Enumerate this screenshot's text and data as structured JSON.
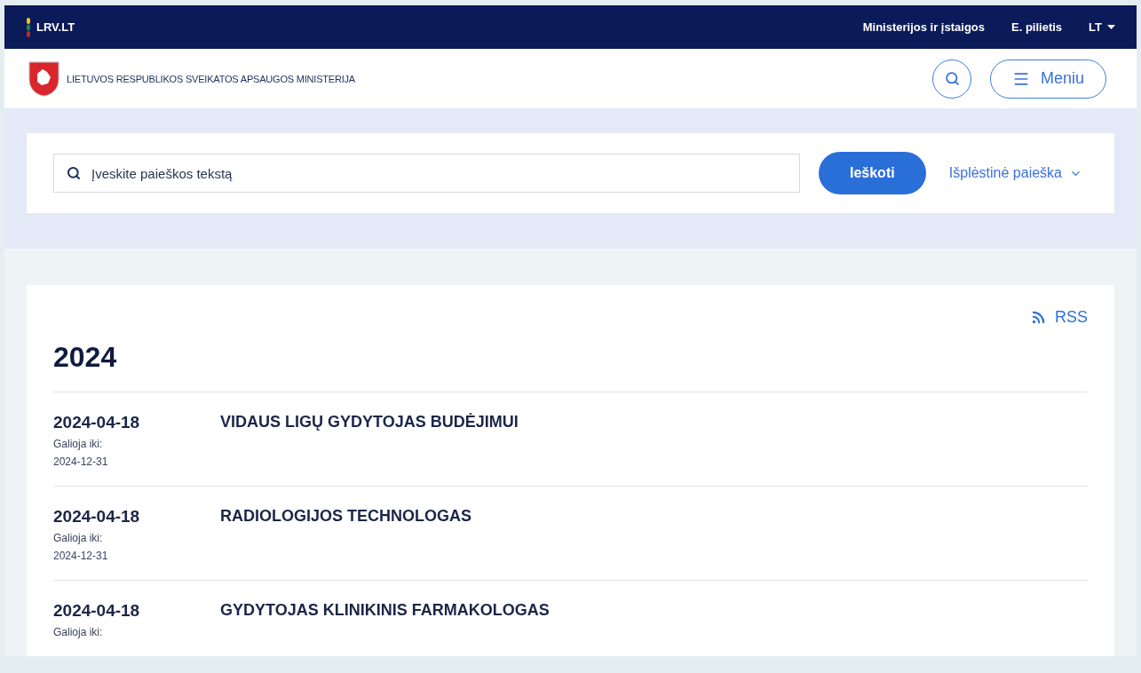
{
  "topbar": {
    "brand": "LRV.LT",
    "links": [
      "Ministerijos ir įstaigos",
      "E. pilietis"
    ],
    "language": "LT"
  },
  "header": {
    "title": "LIETUVOS RESPUBLIKOS SVEIKATOS APSAUGOS MINISTERIJA",
    "menu_button": "Meniu"
  },
  "search": {
    "placeholder": "Įveskite paieškos tekstą",
    "button": "Ieškoti",
    "advanced": "Išplėstinė paieška"
  },
  "feed": {
    "rss": "RSS",
    "year": "2024",
    "items": [
      {
        "date": "2024-04-18",
        "valid_label": "Galioja iki:",
        "valid_until": "2024-12-31",
        "title": "VIDAUS LIGŲ GYDYTOJAS BUDĖJIMUI"
      },
      {
        "date": "2024-04-18",
        "valid_label": "Galioja iki:",
        "valid_until": "2024-12-31",
        "title": "RADIOLOGIJOS TECHNOLOGAS"
      },
      {
        "date": "2024-04-18",
        "valid_label": "Galioja iki:",
        "title": "GYDYTOJAS KLINIKINIS FARMAKOLOGAS"
      }
    ]
  }
}
